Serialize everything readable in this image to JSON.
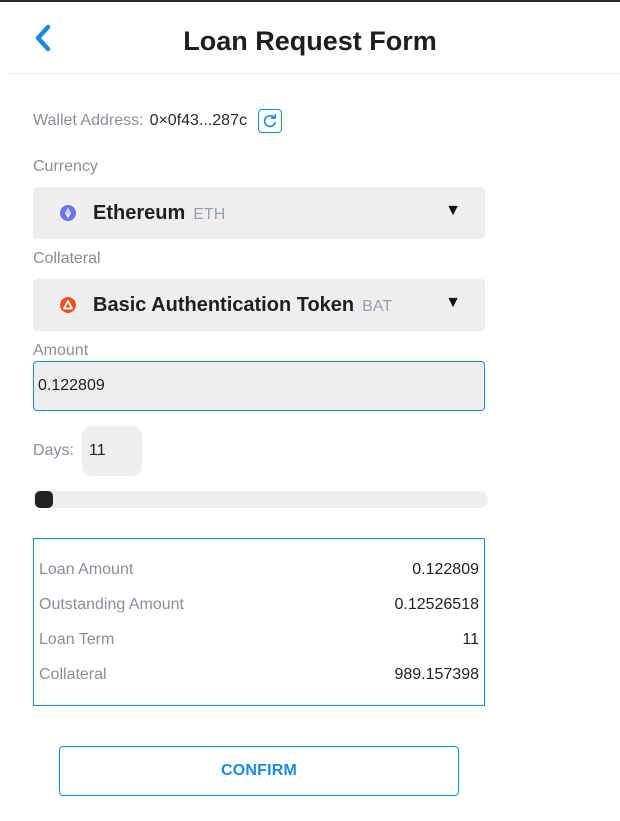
{
  "header": {
    "title": "Loan Request Form",
    "back_icon": "chevron-left-icon"
  },
  "wallet": {
    "label": "Wallet Address:",
    "address": "0×0f43...287c",
    "refresh_icon": "refresh-icon"
  },
  "currency": {
    "label": "Currency",
    "selected_name": "Ethereum",
    "selected_symbol": "ETH",
    "coin_color": "#6b74e8",
    "caret": "▼"
  },
  "collateral": {
    "label": "Collateral",
    "selected_name": "Basic Authentication Token",
    "selected_symbol": "BAT",
    "coin_color": "#f2521e",
    "caret": "▼"
  },
  "amount": {
    "label": "Amount",
    "value": "0.122809"
  },
  "days": {
    "label": "Days:",
    "value": "11",
    "slider_fraction": 0.0
  },
  "summary": {
    "rows": [
      {
        "key": "Loan Amount",
        "value": "0.122809"
      },
      {
        "key": "Outstanding Amount",
        "value": "0.12526518"
      },
      {
        "key": "Loan Term",
        "value": "11"
      },
      {
        "key": "Collateral",
        "value": "989.157398"
      }
    ]
  },
  "confirm_label": "CONFIRM",
  "colors": {
    "accent": "#1a8be0",
    "field_bg": "#eeeeee",
    "label": "#8a8f97"
  }
}
